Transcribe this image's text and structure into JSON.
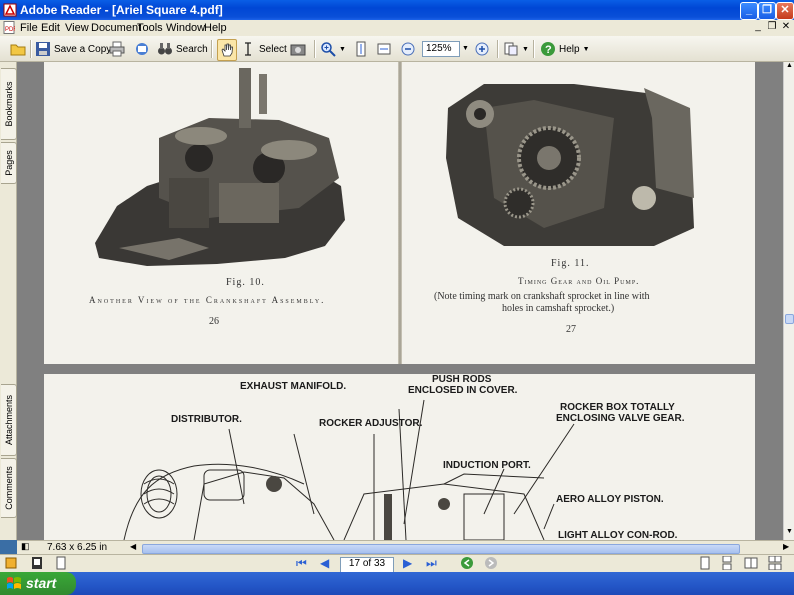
{
  "window": {
    "title": "Adobe Reader - [Ariel Square 4.pdf]"
  },
  "menu": [
    "File",
    "Edit",
    "View",
    "Document",
    "Tools",
    "Window",
    "Help"
  ],
  "toolbar": {
    "save_copy": "Save a Copy",
    "search": "Search",
    "select": "Select",
    "zoom": "125%",
    "help": "Help"
  },
  "nav_tabs": {
    "bookmarks": "Bookmarks",
    "pages": "Pages",
    "attachments": "Attachments",
    "comments": "Comments"
  },
  "document": {
    "left_page": {
      "fig": "Fig. 10.",
      "caption": "Another View of the Crankshaft Assembly.",
      "page_number": "26"
    },
    "right_page": {
      "fig": "Fig. 11.",
      "caption": "Timing Gear and Oil Pump.",
      "note_line1": "(Note timing mark on crankshaft sprocket in line with",
      "note_line2": "holes in camshaft sprocket.)",
      "page_number": "27"
    },
    "lower_page": {
      "labels": {
        "exhaust": "EXHAUST MANIFOLD.",
        "push_rods1": "PUSH RODS",
        "push_rods2": "ENCLOSED IN COVER.",
        "distributor": "DISTRIBUTOR.",
        "rocker_adjustor": "ROCKER ADJUSTOR.",
        "rocker_box1": "ROCKER BOX TOTALLY",
        "rocker_box2": "ENCLOSING VALVE GEAR.",
        "induction": "INDUCTION PORT.",
        "piston": "AERO ALLOY PISTON.",
        "conrod": "LIGHT ALLOY CON-ROD."
      }
    }
  },
  "status": {
    "page_size": "7.63 x 6.25 in",
    "page_indicator": "17 of 33"
  },
  "taskbar": {
    "start": "start"
  },
  "colors": {
    "title_bar": "#0a4fd8",
    "chrome": "#ece9d8",
    "doc_background": "#808080",
    "start_button": "#3aa838"
  }
}
